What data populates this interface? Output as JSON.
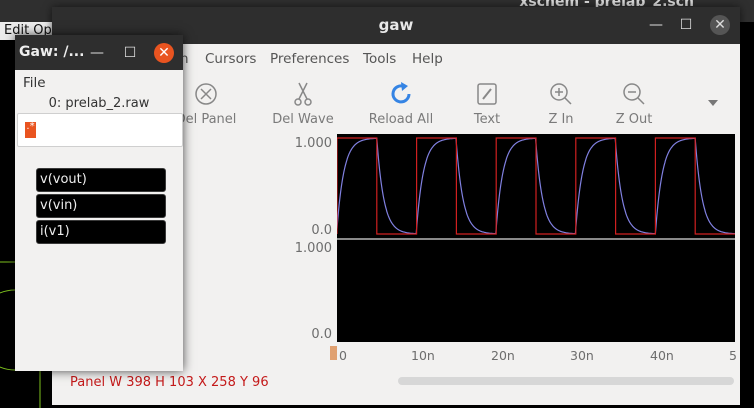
{
  "background_app": {
    "title": "xschem - prelab_2.sch",
    "menu": "Edit  Op"
  },
  "gaw_window": {
    "title": "gaw",
    "menus": [
      "n",
      "Cursors",
      "Preferences",
      "Tools",
      "Help"
    ],
    "toolbar": [
      {
        "label": "Del Panel",
        "icon": "del-panel-icon"
      },
      {
        "label": "Del Wave",
        "icon": "scissors-icon"
      },
      {
        "label": "Reload All",
        "icon": "reload-icon"
      },
      {
        "label": "Text",
        "icon": "text-edit-icon"
      },
      {
        "label": "Z In",
        "icon": "zoom-in-icon"
      },
      {
        "label": "Z Out",
        "icon": "zoom-out-icon"
      }
    ],
    "panel_top_y": {
      "max": "1.000",
      "min": "0.0"
    },
    "panel_bottom_y": {
      "max": "1.000",
      "min": "0.0"
    },
    "x_ticks": [
      "0",
      "10n",
      "20n",
      "30n",
      "40n",
      "5"
    ],
    "status": "Panel W 398 H 103 X 258 Y 96"
  },
  "sub_window": {
    "title": "Gaw: /...",
    "file_menu": "File",
    "filename": "0: prelab_2.raw",
    "input_value": ".*",
    "waves": [
      "v(vout)",
      "v(vin)",
      "i(v1)"
    ]
  },
  "chart_data": {
    "type": "line",
    "series": [
      {
        "name": "v(vin)",
        "color": "#d02020",
        "x": [
          0,
          0,
          5,
          5,
          10,
          10,
          15,
          15,
          20,
          20,
          25,
          25,
          30,
          30,
          35,
          35,
          40,
          40,
          45,
          45,
          50
        ],
        "values": [
          0,
          1,
          1,
          0,
          0,
          1,
          1,
          0,
          0,
          1,
          1,
          0,
          0,
          1,
          1,
          0,
          0,
          1,
          1,
          0,
          0
        ]
      },
      {
        "name": "v(vout)",
        "color": "#8080e0"
      }
    ],
    "xlim": [
      0,
      50
    ],
    "ylim": [
      0,
      1
    ],
    "x_unit": "n"
  }
}
